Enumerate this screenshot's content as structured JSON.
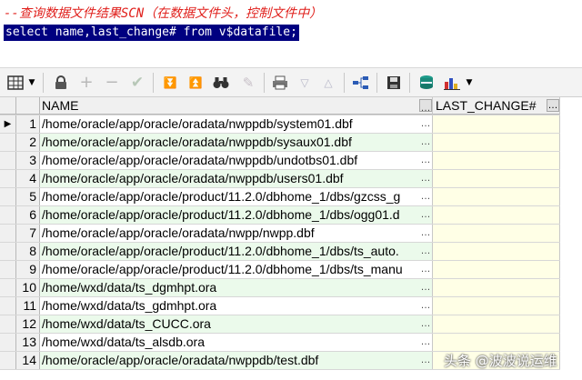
{
  "editor": {
    "comment": "--查询数据文件结果SCN（在数据文件头，控制文件中）",
    "sql": "select name,last_change# from v$datafile;"
  },
  "toolbar": {
    "icons": [
      "grid-icon",
      "dropdown-arrow-icon",
      "lock-icon",
      "plus-icon",
      "minus-icon",
      "check-icon",
      "double-down-icon",
      "double-up-icon",
      "binoculars-icon",
      "eraser-icon",
      "print-icon",
      "triangle-down-icon",
      "triangle-up-icon",
      "tree-icon",
      "save-icon",
      "database-icon",
      "chart-icon"
    ]
  },
  "grid": {
    "columns": [
      "NAME",
      "LAST_CHANGE#"
    ],
    "current_row_marker": "▶",
    "rows": [
      {
        "n": "1",
        "name": "/home/oracle/app/oracle/oradata/nwppdb/system01.dbf",
        "last_change": ""
      },
      {
        "n": "2",
        "name": "/home/oracle/app/oracle/oradata/nwppdb/sysaux01.dbf",
        "last_change": ""
      },
      {
        "n": "3",
        "name": "/home/oracle/app/oracle/oradata/nwppdb/undotbs01.dbf",
        "last_change": ""
      },
      {
        "n": "4",
        "name": "/home/oracle/app/oracle/oradata/nwppdb/users01.dbf",
        "last_change": ""
      },
      {
        "n": "5",
        "name": "/home/oracle/app/oracle/product/11.2.0/dbhome_1/dbs/gzcss_g",
        "last_change": ""
      },
      {
        "n": "6",
        "name": "/home/oracle/app/oracle/product/11.2.0/dbhome_1/dbs/ogg01.d",
        "last_change": ""
      },
      {
        "n": "7",
        "name": "/home/oracle/app/oracle/oradata/nwpp/nwpp.dbf",
        "last_change": ""
      },
      {
        "n": "8",
        "name": "/home/oracle/app/oracle/product/11.2.0/dbhome_1/dbs/ts_auto.",
        "last_change": ""
      },
      {
        "n": "9",
        "name": "/home/oracle/app/oracle/product/11.2.0/dbhome_1/dbs/ts_manu",
        "last_change": ""
      },
      {
        "n": "10",
        "name": "/home/wxd/data/ts_dgmhpt.ora",
        "last_change": ""
      },
      {
        "n": "11",
        "name": "/home/wxd/data/ts_gdmhpt.ora",
        "last_change": ""
      },
      {
        "n": "12",
        "name": "/home/wxd/data/ts_CUCC.ora",
        "last_change": ""
      },
      {
        "n": "13",
        "name": "/home/wxd/data/ts_alsdb.ora",
        "last_change": ""
      },
      {
        "n": "14",
        "name": "/home/oracle/app/oracle/oradata/nwppdb/test.dbf",
        "last_change": ""
      }
    ]
  },
  "watermark": "头条 @波波说运维"
}
